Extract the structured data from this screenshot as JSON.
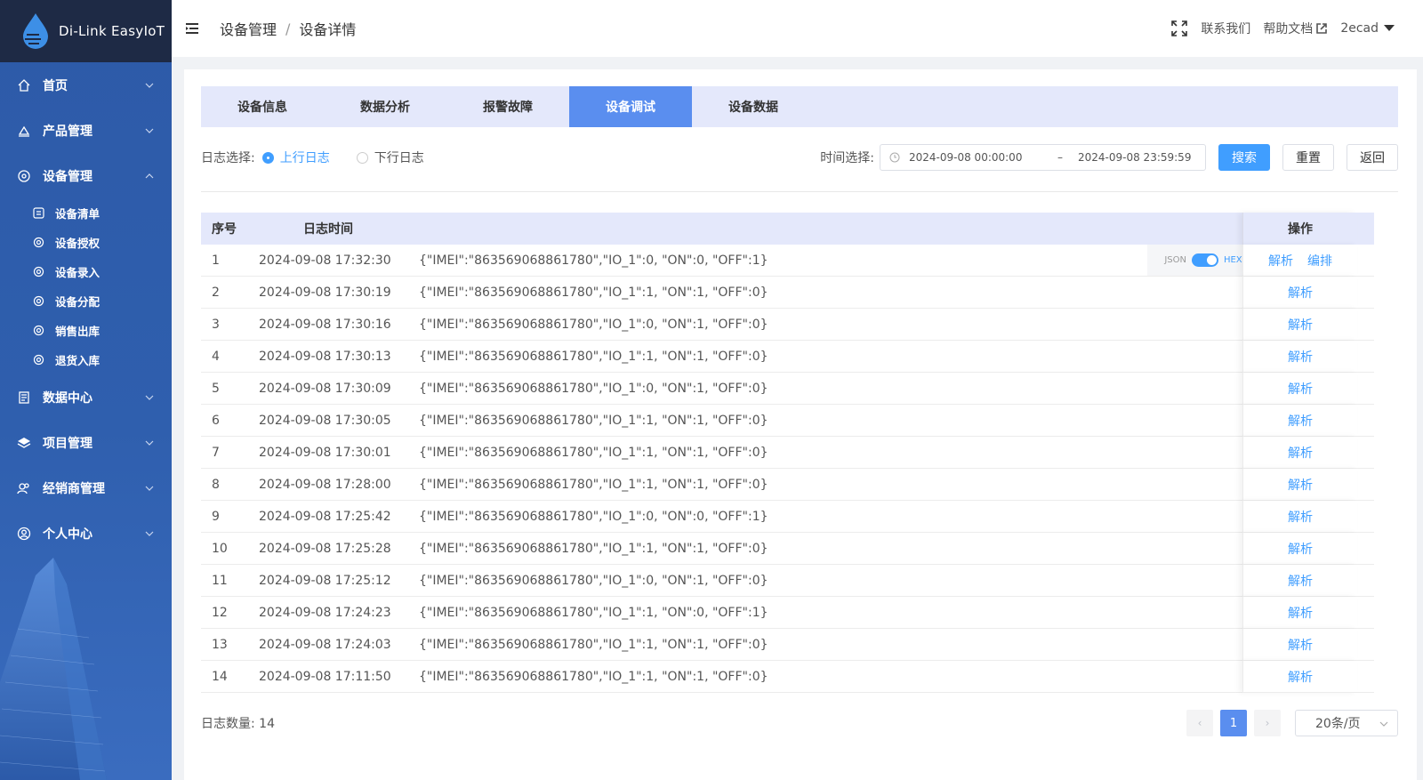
{
  "app": {
    "name": "Di-Link EasyIoT"
  },
  "sidebar": {
    "items": [
      {
        "label": "首页",
        "icon": "home-icon"
      },
      {
        "label": "产品管理",
        "icon": "product-icon"
      },
      {
        "label": "设备管理",
        "icon": "device-icon",
        "expanded": true,
        "children": [
          {
            "label": "设备清单",
            "icon": "list-icon"
          },
          {
            "label": "设备授权",
            "icon": "gear-icon"
          },
          {
            "label": "设备录入",
            "icon": "gear-icon"
          },
          {
            "label": "设备分配",
            "icon": "gear-icon"
          },
          {
            "label": "销售出库",
            "icon": "gear-icon"
          },
          {
            "label": "退货入库",
            "icon": "gear-icon"
          }
        ]
      },
      {
        "label": "数据中心",
        "icon": "data-icon"
      },
      {
        "label": "项目管理",
        "icon": "layers-icon"
      },
      {
        "label": "经销商管理",
        "icon": "users-icon"
      },
      {
        "label": "个人中心",
        "icon": "user-icon"
      }
    ]
  },
  "header": {
    "breadcrumb": [
      "设备管理",
      "设备详情"
    ],
    "contact": "联系我们",
    "help": "帮助文档",
    "user": "2ecad"
  },
  "tabs": [
    {
      "label": "设备信息",
      "active": false
    },
    {
      "label": "数据分析",
      "active": false
    },
    {
      "label": "报警故障",
      "active": false
    },
    {
      "label": "设备调试",
      "active": true
    },
    {
      "label": "设备数据",
      "active": false
    }
  ],
  "filters": {
    "log_label": "日志选择:",
    "uplink": "上行日志",
    "downlink": "下行日志",
    "time_label": "时间选择:",
    "start": "2024-09-08 00:00:00",
    "range_sep": "–",
    "end": "2024-09-08 23:59:59",
    "search": "搜索",
    "reset": "重置",
    "back": "返回"
  },
  "table": {
    "headers": {
      "no": "序号",
      "time": "日志时间",
      "op": "操作"
    },
    "toggle": {
      "json": "JSON",
      "hex": "HEX"
    },
    "op_parse": "解析",
    "op_edit": "编排",
    "rows": [
      {
        "no": "1",
        "time": "2024-09-08 17:32:30",
        "data": "{\"IMEI\":\"863569068861780\",\"IO_1\":0, \"ON\":0, \"OFF\":1}"
      },
      {
        "no": "2",
        "time": "2024-09-08 17:30:19",
        "data": "{\"IMEI\":\"863569068861780\",\"IO_1\":1, \"ON\":1, \"OFF\":0}"
      },
      {
        "no": "3",
        "time": "2024-09-08 17:30:16",
        "data": "{\"IMEI\":\"863569068861780\",\"IO_1\":0, \"ON\":1, \"OFF\":0}"
      },
      {
        "no": "4",
        "time": "2024-09-08 17:30:13",
        "data": "{\"IMEI\":\"863569068861780\",\"IO_1\":1, \"ON\":1, \"OFF\":0}"
      },
      {
        "no": "5",
        "time": "2024-09-08 17:30:09",
        "data": "{\"IMEI\":\"863569068861780\",\"IO_1\":0, \"ON\":1, \"OFF\":0}"
      },
      {
        "no": "6",
        "time": "2024-09-08 17:30:05",
        "data": "{\"IMEI\":\"863569068861780\",\"IO_1\":1, \"ON\":1, \"OFF\":0}"
      },
      {
        "no": "7",
        "time": "2024-09-08 17:30:01",
        "data": "{\"IMEI\":\"863569068861780\",\"IO_1\":1, \"ON\":1, \"OFF\":0}"
      },
      {
        "no": "8",
        "time": "2024-09-08 17:28:00",
        "data": "{\"IMEI\":\"863569068861780\",\"IO_1\":1, \"ON\":1, \"OFF\":0}"
      },
      {
        "no": "9",
        "time": "2024-09-08 17:25:42",
        "data": "{\"IMEI\":\"863569068861780\",\"IO_1\":0, \"ON\":0, \"OFF\":1}"
      },
      {
        "no": "10",
        "time": "2024-09-08 17:25:28",
        "data": "{\"IMEI\":\"863569068861780\",\"IO_1\":1, \"ON\":1, \"OFF\":0}"
      },
      {
        "no": "11",
        "time": "2024-09-08 17:25:12",
        "data": "{\"IMEI\":\"863569068861780\",\"IO_1\":0, \"ON\":1, \"OFF\":0}"
      },
      {
        "no": "12",
        "time": "2024-09-08 17:24:23",
        "data": "{\"IMEI\":\"863569068861780\",\"IO_1\":1, \"ON\":0, \"OFF\":1}"
      },
      {
        "no": "13",
        "time": "2024-09-08 17:24:03",
        "data": "{\"IMEI\":\"863569068861780\",\"IO_1\":1, \"ON\":1, \"OFF\":0}"
      },
      {
        "no": "14",
        "time": "2024-09-08 17:11:50",
        "data": "{\"IMEI\":\"863569068861780\",\"IO_1\":1, \"ON\":1, \"OFF\":0}"
      }
    ]
  },
  "footer": {
    "count_label": "日志数量: 14",
    "prev": "‹",
    "page": "1",
    "next": "›",
    "page_size": "20条/页"
  },
  "colors": {
    "accent": "#409eff",
    "tab_active": "#5a8eef",
    "sidebar": "#2f5fae",
    "logo_bar": "#1e2a45"
  }
}
